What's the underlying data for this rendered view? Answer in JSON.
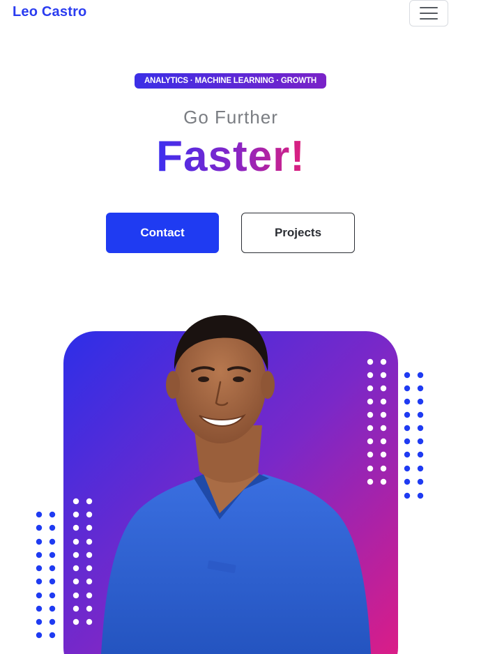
{
  "header": {
    "brand": "Leo Castro",
    "menu_icon": "hamburger-menu-icon"
  },
  "hero": {
    "badge": "ANALYTICS · MACHINE LEARNING · GROWTH",
    "subtitle": "Go Further",
    "headline": "Faster!",
    "buttons": {
      "contact": "Contact",
      "projects": "Projects"
    }
  },
  "colors": {
    "brand_blue": "#2a3cf0",
    "primary_button": "#1f3bf2",
    "gradient_start": "#3c2ff0",
    "gradient_mid": "#8a25c4",
    "gradient_end": "#e0207a",
    "scrub_blue": "#2f63d4"
  },
  "portrait": {
    "description_icon": "person-portrait-icon"
  }
}
